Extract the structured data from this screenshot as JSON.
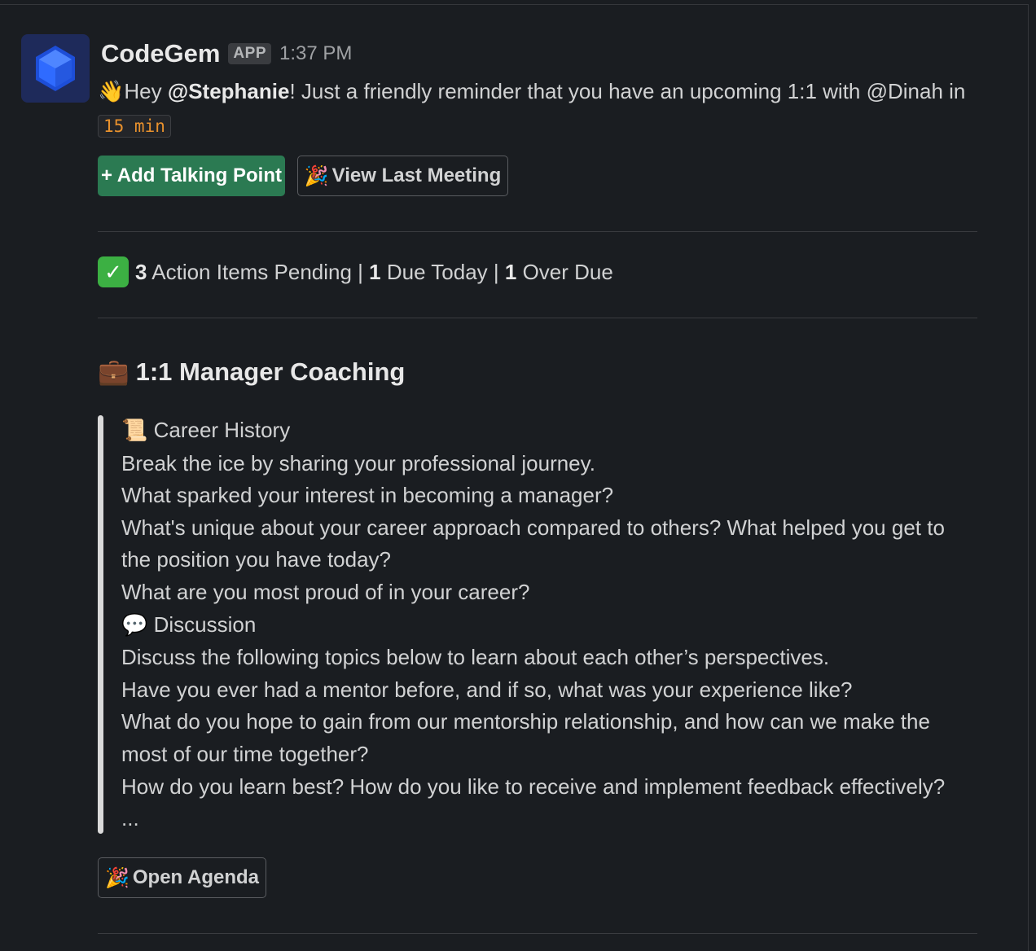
{
  "message": {
    "app_name": "CodeGem",
    "app_badge": "APP",
    "timestamp": "1:37 PM",
    "greeting": "Hey ",
    "mention_user": "@Stephanie",
    "text_1": "! Just a friendly reminder that you have an upcoming 1:1 with @Dinah in ",
    "time_code": "15 min"
  },
  "buttons": {
    "add_talking_point": "+ Add Talking Point",
    "view_last_meeting": "View Last Meeting",
    "open_agenda": "Open Agenda"
  },
  "status": {
    "pending_count": "3",
    "pending_label": " Action Items Pending | ",
    "due_today_count": "1",
    "due_today_label": " Due Today | ",
    "over_due_count": "1",
    "over_due_label": " Over Due"
  },
  "section": {
    "title": "1:1 Manager Coaching"
  },
  "agenda": {
    "career_title": "Career History",
    "career_lines": [
      "Break the ice by sharing your professional journey.",
      "What sparked your interest in becoming a manager?",
      "What's unique about your career approach compared to others? What helped you get to the position you have today?",
      "What are you most proud of in your career?"
    ],
    "discussion_title": "Discussion",
    "discussion_lines": [
      "Discuss the following topics below to learn about each other’s perspectives.",
      "Have you ever had a mentor before, and if so, what was your experience like?",
      "What do you hope to gain from our mentorship relationship, and how can we make the most of our time together?",
      "How do you learn best? How do you like to receive and implement feedback effectively?"
    ],
    "ellipsis": "..."
  },
  "icons": {
    "avatar": "hexagon-logo-icon",
    "wave": "waving-hand-icon",
    "party": "party-popper-icon",
    "check": "check-mark-icon",
    "briefcase": "briefcase-icon",
    "scroll": "scroll-icon",
    "speech": "speech-bubble-icon"
  },
  "colors": {
    "background": "#1a1d21",
    "primary_button": "#2b7a52",
    "code_text": "#e8912d",
    "avatar_blue": "#2f6bff",
    "check_green": "#3cb043"
  }
}
